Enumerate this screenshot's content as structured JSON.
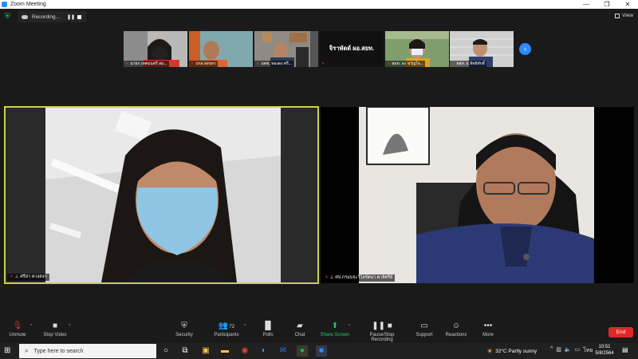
{
  "window": {
    "title": "Zoom Meeting",
    "controls": [
      "—",
      "❐",
      "✕"
    ]
  },
  "recording": {
    "label": "Recording...",
    "view_label": "View"
  },
  "thumbnails": [
    {
      "name": "นายก เทศมนตรี สม...",
      "color": "#7a7a7a"
    },
    {
      "name": "ปกส.สงขลา",
      "color": "#8a6a55"
    },
    {
      "name": "นพช. ทองดง ศรี...",
      "color": "#6a6c70"
    },
    {
      "name": "จิราพัตต์ ผอ.สยท.",
      "color": "#111111"
    },
    {
      "name": "สมท. ละ ขวัญใจ...",
      "color": "#6f8a5a"
    },
    {
      "name": "ทสท. ธ สิทธิศักดิ์",
      "color": "#c9c9c9"
    }
  ],
  "center_thumb_text": "จิราพัตต์ ผอ.สยท.",
  "main_videos": {
    "left_name": "ศรีลา ควงสงก",
    "right_name": "ศป.กรมบจะวีไลรัตนา ตาลิศรีย์"
  },
  "toolbar": {
    "unmute": "Unmute",
    "stop_video": "Stop Video",
    "security": "Security",
    "participants": "Participants",
    "participants_count": "72",
    "polls": "Polls",
    "chat": "Chat",
    "share_screen": "Share Screen",
    "record": "Pause/Stop Recording",
    "support": "Support",
    "reactions": "Reactions",
    "more": "More",
    "end": "End"
  },
  "taskbar": {
    "search_placeholder": "Type here to search",
    "weather": "32°C  Partly sunny",
    "lang": "ไทย",
    "time": "10:51",
    "date": "5/8/2564"
  },
  "colors": {
    "accent": "#2d8cff",
    "active_speaker": "#c8d34c",
    "end": "#e02828",
    "share": "#1ecb61"
  }
}
